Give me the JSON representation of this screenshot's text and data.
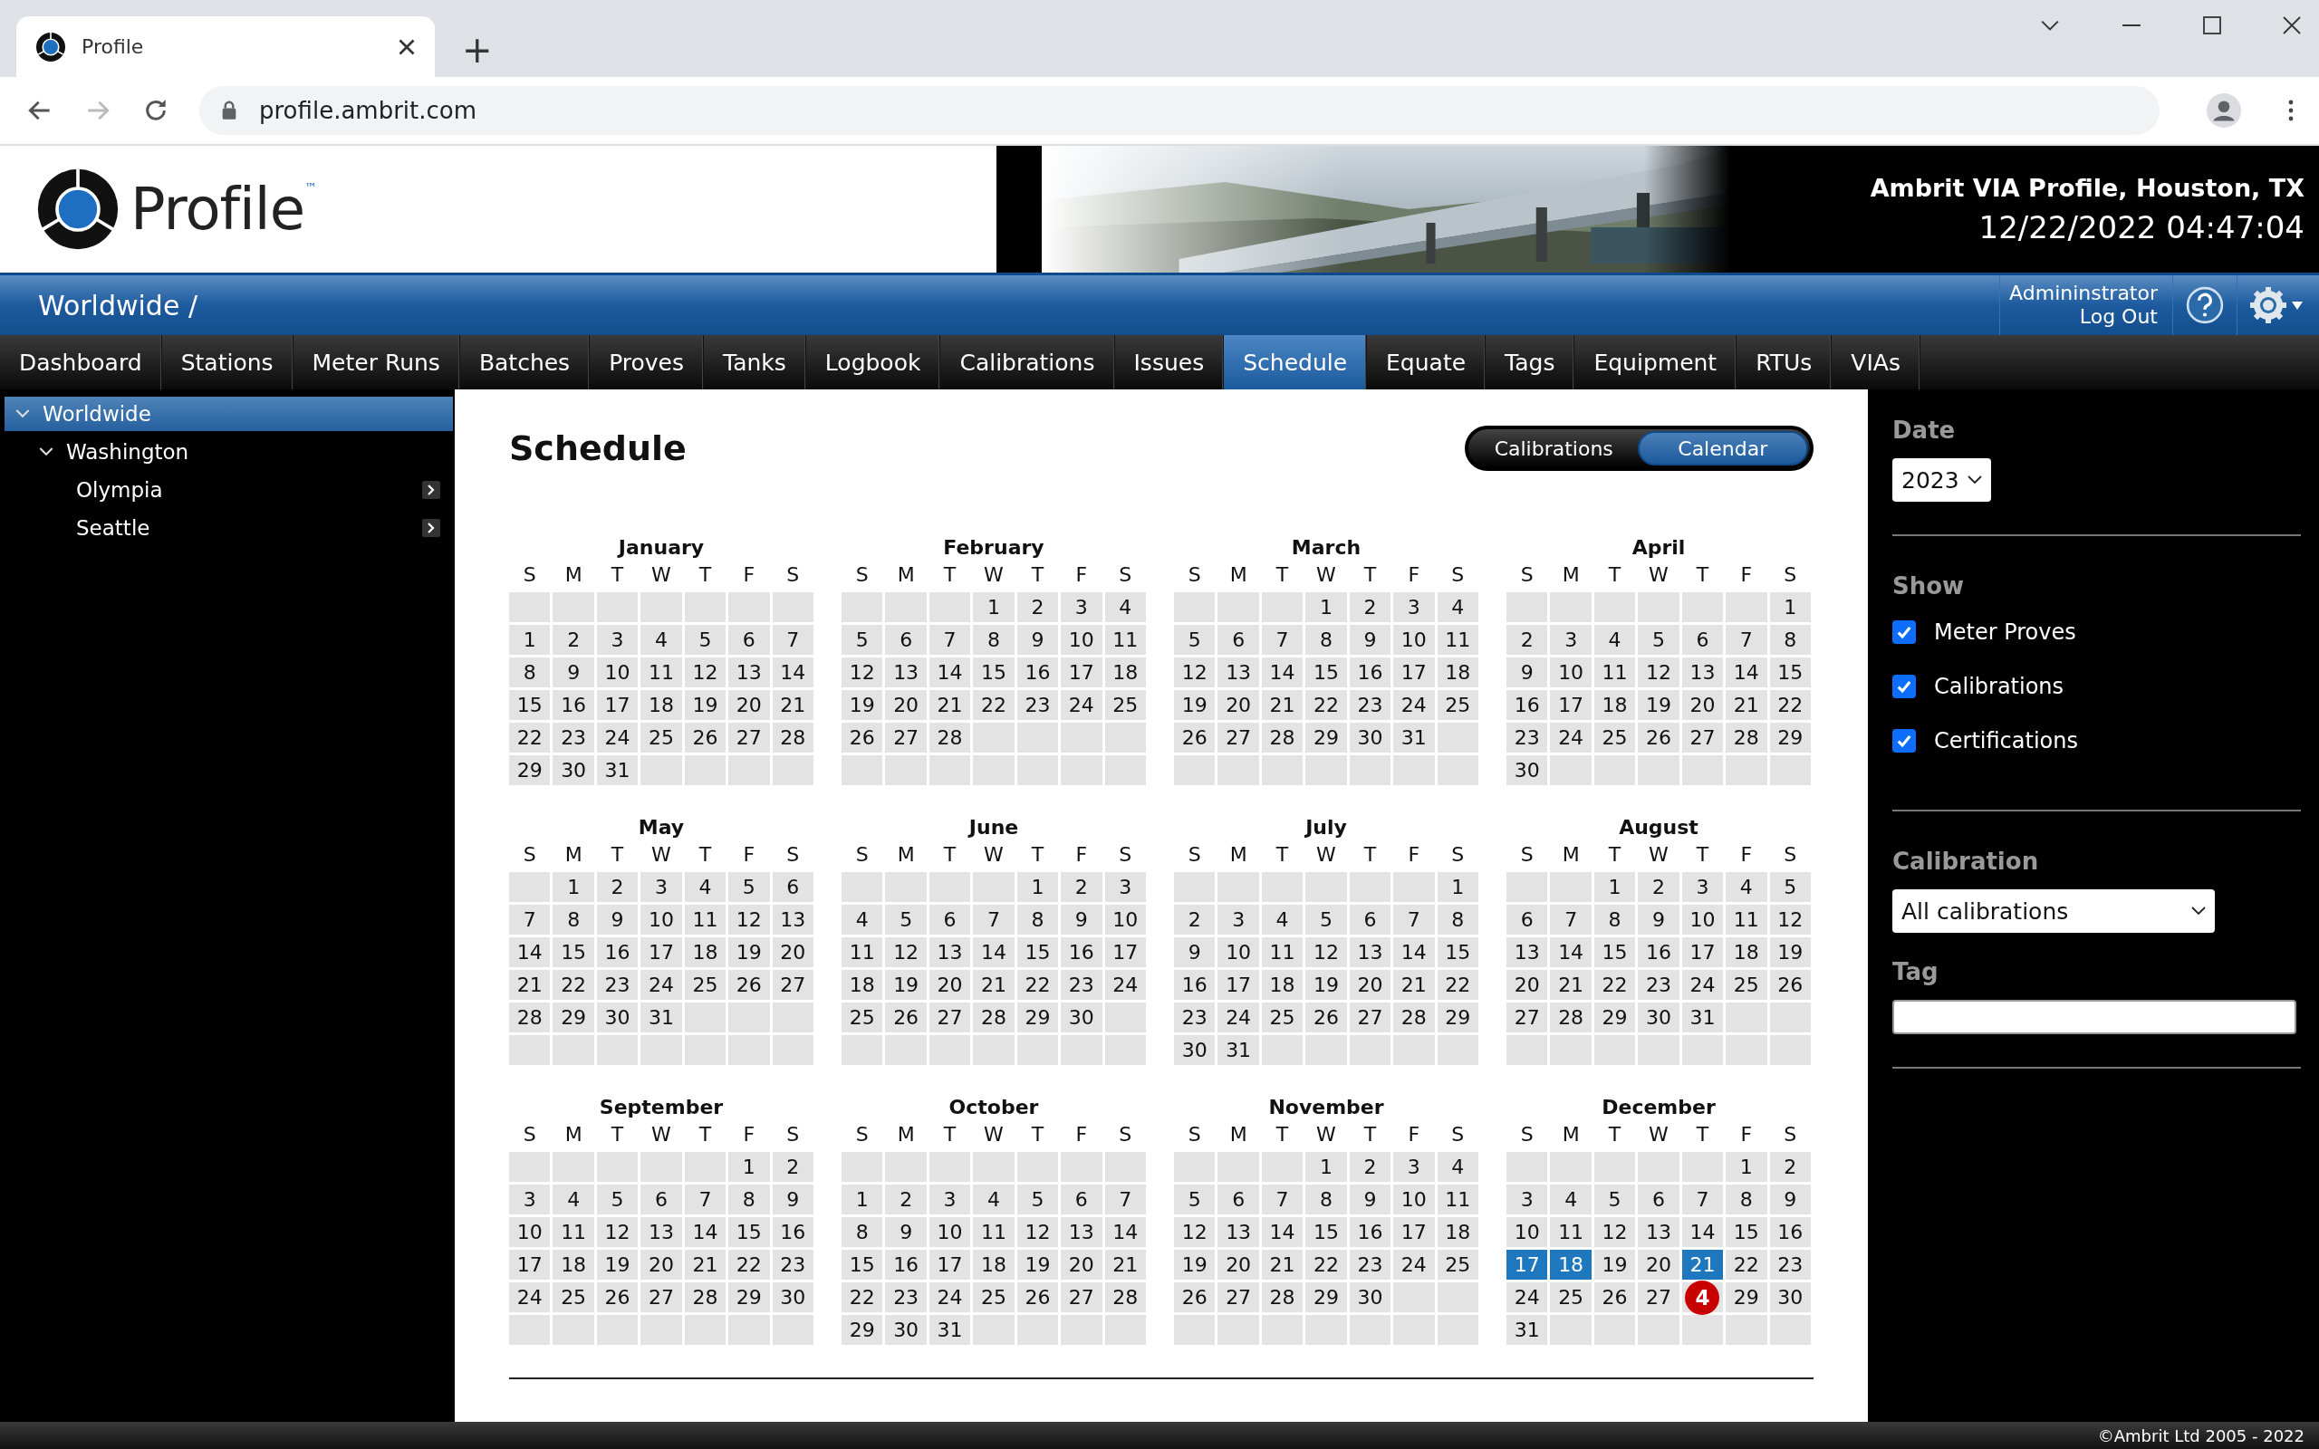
{
  "browser": {
    "tab_title": "Profile",
    "new_tab": "+",
    "url": "profile.ambrit.com"
  },
  "header": {
    "logo_text": "Profile",
    "trademark": "™",
    "site": "Ambrit VIA Profile, Houston, TX",
    "datetime": "12/22/2022 04:47:04"
  },
  "breadcrumb": "Worldwide /",
  "user": {
    "name": "Admininstrator",
    "logout": "Log Out"
  },
  "nav": [
    {
      "label": "Dashboard",
      "selected": false
    },
    {
      "label": "Stations",
      "selected": false
    },
    {
      "label": "Meter Runs",
      "selected": false
    },
    {
      "label": "Batches",
      "selected": false
    },
    {
      "label": "Proves",
      "selected": false
    },
    {
      "label": "Tanks",
      "selected": false
    },
    {
      "label": "Logbook",
      "selected": false
    },
    {
      "label": "Calibrations",
      "selected": false
    },
    {
      "label": "Issues",
      "selected": false
    },
    {
      "label": "Schedule",
      "selected": true
    },
    {
      "label": "Equate",
      "selected": false
    },
    {
      "label": "Tags",
      "selected": false
    },
    {
      "label": "Equipment",
      "selected": false
    },
    {
      "label": "RTUs",
      "selected": false
    },
    {
      "label": "VIAs",
      "selected": false
    }
  ],
  "tree": [
    {
      "label": "Worldwide",
      "selected": true,
      "expanded": true,
      "children": [
        {
          "label": "Washington",
          "selected": false,
          "expanded": true,
          "children": [
            {
              "label": "Olympia",
              "selected": false
            },
            {
              "label": "Seattle",
              "selected": false
            }
          ]
        }
      ]
    }
  ],
  "page_title": "Schedule",
  "view_toggle": [
    {
      "label": "Calibrations",
      "selected": false
    },
    {
      "label": "Calendar",
      "selected": true
    }
  ],
  "months": [
    {
      "name": "January",
      "weekdays": [
        "S",
        "M",
        "T",
        "W",
        "T",
        "F",
        "S"
      ],
      "weeks": [
        [
          {
            "kind": "blank"
          },
          {
            "kind": "blank"
          },
          {
            "kind": "blank"
          },
          {
            "kind": "blank"
          },
          {
            "kind": "blank"
          },
          {
            "kind": "blank"
          },
          {
            "kind": "blank"
          }
        ],
        [
          "1",
          "2",
          "3",
          "4",
          "5",
          "6",
          "7"
        ],
        [
          "8",
          "9",
          "10",
          "11",
          "12",
          "13",
          "14"
        ],
        [
          "15",
          "16",
          "17",
          "18",
          "19",
          "20",
          "21"
        ],
        [
          "22",
          "23",
          "24",
          "25",
          "26",
          "27",
          "28"
        ],
        [
          "29",
          "30",
          "31",
          {
            "kind": "blank"
          },
          {
            "kind": "blank"
          },
          {
            "kind": "blank"
          },
          {
            "kind": "blank"
          }
        ]
      ]
    },
    {
      "name": "February",
      "weekdays": [
        "S",
        "M",
        "T",
        "W",
        "T",
        "F",
        "S"
      ],
      "weeks": [
        [
          {
            "kind": "blank"
          },
          {
            "kind": "blank"
          },
          {
            "kind": "blank"
          },
          "1",
          "2",
          "3",
          "4"
        ],
        [
          "5",
          "6",
          "7",
          "8",
          "9",
          "10",
          "11"
        ],
        [
          "12",
          "13",
          "14",
          "15",
          "16",
          "17",
          "18"
        ],
        [
          "19",
          "20",
          "21",
          "22",
          "23",
          "24",
          "25"
        ],
        [
          "26",
          "27",
          "28",
          {
            "kind": "blank"
          },
          {
            "kind": "blank"
          },
          {
            "kind": "blank"
          },
          {
            "kind": "blank"
          }
        ],
        [
          {
            "kind": "blank"
          },
          {
            "kind": "blank"
          },
          {
            "kind": "blank"
          },
          {
            "kind": "blank"
          },
          {
            "kind": "blank"
          },
          {
            "kind": "blank"
          },
          {
            "kind": "blank"
          }
        ]
      ]
    },
    {
      "name": "March",
      "weekdays": [
        "S",
        "M",
        "T",
        "W",
        "T",
        "F",
        "S"
      ],
      "weeks": [
        [
          {
            "kind": "blank"
          },
          {
            "kind": "blank"
          },
          {
            "kind": "blank"
          },
          "1",
          "2",
          "3",
          "4"
        ],
        [
          "5",
          "6",
          "7",
          "8",
          "9",
          "10",
          "11"
        ],
        [
          "12",
          "13",
          "14",
          "15",
          "16",
          "17",
          "18"
        ],
        [
          "19",
          "20",
          "21",
          "22",
          "23",
          "24",
          "25"
        ],
        [
          "26",
          "27",
          "28",
          "29",
          "30",
          "31",
          {
            "kind": "blank"
          }
        ],
        [
          {
            "kind": "blank"
          },
          {
            "kind": "blank"
          },
          {
            "kind": "blank"
          },
          {
            "kind": "blank"
          },
          {
            "kind": "blank"
          },
          {
            "kind": "blank"
          },
          {
            "kind": "blank"
          }
        ]
      ]
    },
    {
      "name": "April",
      "weekdays": [
        "S",
        "M",
        "T",
        "W",
        "T",
        "F",
        "S"
      ],
      "weeks": [
        [
          {
            "kind": "blank"
          },
          {
            "kind": "blank"
          },
          {
            "kind": "blank"
          },
          {
            "kind": "blank"
          },
          {
            "kind": "blank"
          },
          {
            "kind": "blank"
          },
          "1"
        ],
        [
          "2",
          "3",
          "4",
          "5",
          "6",
          "7",
          "8"
        ],
        [
          "9",
          "10",
          "11",
          "12",
          "13",
          "14",
          "15"
        ],
        [
          "16",
          "17",
          "18",
          "19",
          "20",
          "21",
          "22"
        ],
        [
          "23",
          "24",
          "25",
          "26",
          "27",
          "28",
          "29"
        ],
        [
          "30",
          {
            "kind": "blank"
          },
          {
            "kind": "blank"
          },
          {
            "kind": "blank"
          },
          {
            "kind": "blank"
          },
          {
            "kind": "blank"
          },
          {
            "kind": "blank"
          }
        ]
      ]
    },
    {
      "name": "May",
      "weekdays": [
        "S",
        "M",
        "T",
        "W",
        "T",
        "F",
        "S"
      ],
      "weeks": [
        [
          {
            "kind": "blank"
          },
          "1",
          "2",
          "3",
          "4",
          "5",
          "6"
        ],
        [
          "7",
          "8",
          "9",
          "10",
          "11",
          "12",
          "13"
        ],
        [
          "14",
          "15",
          "16",
          "17",
          "18",
          "19",
          "20"
        ],
        [
          "21",
          "22",
          "23",
          "24",
          "25",
          "26",
          "27"
        ],
        [
          "28",
          "29",
          "30",
          "31",
          {
            "kind": "blank"
          },
          {
            "kind": "blank"
          },
          {
            "kind": "blank"
          }
        ],
        [
          {
            "kind": "blank"
          },
          {
            "kind": "blank"
          },
          {
            "kind": "blank"
          },
          {
            "kind": "blank"
          },
          {
            "kind": "blank"
          },
          {
            "kind": "blank"
          },
          {
            "kind": "blank"
          }
        ]
      ]
    },
    {
      "name": "June",
      "weekdays": [
        "S",
        "M",
        "T",
        "W",
        "T",
        "F",
        "S"
      ],
      "weeks": [
        [
          {
            "kind": "blank"
          },
          {
            "kind": "blank"
          },
          {
            "kind": "blank"
          },
          {
            "kind": "blank"
          },
          "1",
          "2",
          "3"
        ],
        [
          "4",
          "5",
          "6",
          "7",
          "8",
          "9",
          "10"
        ],
        [
          "11",
          "12",
          "13",
          "14",
          "15",
          "16",
          "17"
        ],
        [
          "18",
          "19",
          "20",
          "21",
          "22",
          "23",
          "24"
        ],
        [
          "25",
          "26",
          "27",
          "28",
          "29",
          "30",
          {
            "kind": "blank"
          }
        ],
        [
          {
            "kind": "blank"
          },
          {
            "kind": "blank"
          },
          {
            "kind": "blank"
          },
          {
            "kind": "blank"
          },
          {
            "kind": "blank"
          },
          {
            "kind": "blank"
          },
          {
            "kind": "blank"
          }
        ]
      ]
    },
    {
      "name": "July",
      "weekdays": [
        "S",
        "M",
        "T",
        "W",
        "T",
        "F",
        "S"
      ],
      "weeks": [
        [
          {
            "kind": "blank"
          },
          {
            "kind": "blank"
          },
          {
            "kind": "blank"
          },
          {
            "kind": "blank"
          },
          {
            "kind": "blank"
          },
          {
            "kind": "blank"
          },
          "1"
        ],
        [
          "2",
          "3",
          "4",
          "5",
          "6",
          "7",
          "8"
        ],
        [
          "9",
          "10",
          "11",
          "12",
          "13",
          "14",
          "15"
        ],
        [
          "16",
          "17",
          "18",
          "19",
          "20",
          "21",
          "22"
        ],
        [
          "23",
          "24",
          "25",
          "26",
          "27",
          "28",
          "29"
        ],
        [
          "30",
          "31",
          {
            "kind": "blank"
          },
          {
            "kind": "blank"
          },
          {
            "kind": "blank"
          },
          {
            "kind": "blank"
          },
          {
            "kind": "blank"
          }
        ]
      ]
    },
    {
      "name": "August",
      "weekdays": [
        "S",
        "M",
        "T",
        "W",
        "T",
        "F",
        "S"
      ],
      "weeks": [
        [
          {
            "kind": "blank"
          },
          {
            "kind": "blank"
          },
          "1",
          "2",
          "3",
          "4",
          "5"
        ],
        [
          "6",
          "7",
          "8",
          "9",
          "10",
          "11",
          "12"
        ],
        [
          "13",
          "14",
          "15",
          "16",
          "17",
          "18",
          "19"
        ],
        [
          "20",
          "21",
          "22",
          "23",
          "24",
          "25",
          "26"
        ],
        [
          "27",
          "28",
          "29",
          "30",
          "31",
          {
            "kind": "blank"
          },
          {
            "kind": "blank"
          }
        ],
        [
          {
            "kind": "blank"
          },
          {
            "kind": "blank"
          },
          {
            "kind": "blank"
          },
          {
            "kind": "blank"
          },
          {
            "kind": "blank"
          },
          {
            "kind": "blank"
          },
          {
            "kind": "blank"
          }
        ]
      ]
    },
    {
      "name": "September",
      "weekdays": [
        "S",
        "M",
        "T",
        "W",
        "T",
        "F",
        "S"
      ],
      "weeks": [
        [
          {
            "kind": "blank"
          },
          {
            "kind": "blank"
          },
          {
            "kind": "blank"
          },
          {
            "kind": "blank"
          },
          {
            "kind": "blank"
          },
          "1",
          "2"
        ],
        [
          "3",
          "4",
          "5",
          "6",
          "7",
          "8",
          "9"
        ],
        [
          "10",
          "11",
          "12",
          "13",
          "14",
          "15",
          "16"
        ],
        [
          "17",
          "18",
          "19",
          "20",
          "21",
          "22",
          "23"
        ],
        [
          "24",
          "25",
          "26",
          "27",
          "28",
          "29",
          "30"
        ],
        [
          {
            "kind": "blank"
          },
          {
            "kind": "blank"
          },
          {
            "kind": "blank"
          },
          {
            "kind": "blank"
          },
          {
            "kind": "blank"
          },
          {
            "kind": "blank"
          },
          {
            "kind": "blank"
          }
        ]
      ]
    },
    {
      "name": "October",
      "weekdays": [
        "S",
        "M",
        "T",
        "W",
        "T",
        "F",
        "S"
      ],
      "weeks": [
        [
          {
            "kind": "blank"
          },
          {
            "kind": "blank"
          },
          {
            "kind": "blank"
          },
          {
            "kind": "blank"
          },
          {
            "kind": "blank"
          },
          {
            "kind": "blank"
          },
          {
            "kind": "blank"
          }
        ],
        [
          "1",
          "2",
          "3",
          "4",
          "5",
          "6",
          "7"
        ],
        [
          "8",
          "9",
          "10",
          "11",
          "12",
          "13",
          "14"
        ],
        [
          "15",
          "16",
          "17",
          "18",
          "19",
          "20",
          "21"
        ],
        [
          "22",
          "23",
          "24",
          "25",
          "26",
          "27",
          "28"
        ],
        [
          "29",
          "30",
          "31",
          {
            "kind": "blank"
          },
          {
            "kind": "blank"
          },
          {
            "kind": "blank"
          },
          {
            "kind": "blank"
          }
        ]
      ]
    },
    {
      "name": "November",
      "weekdays": [
        "S",
        "M",
        "T",
        "W",
        "T",
        "F",
        "S"
      ],
      "weeks": [
        [
          {
            "kind": "blank"
          },
          {
            "kind": "blank"
          },
          {
            "kind": "blank"
          },
          "1",
          "2",
          "3",
          "4"
        ],
        [
          "5",
          "6",
          "7",
          "8",
          "9",
          "10",
          "11"
        ],
        [
          "12",
          "13",
          "14",
          "15",
          "16",
          "17",
          "18"
        ],
        [
          "19",
          "20",
          "21",
          "22",
          "23",
          "24",
          "25"
        ],
        [
          "26",
          "27",
          "28",
          "29",
          "30",
          {
            "kind": "blank"
          },
          {
            "kind": "blank"
          }
        ],
        [
          {
            "kind": "blank"
          },
          {
            "kind": "blank"
          },
          {
            "kind": "blank"
          },
          {
            "kind": "blank"
          },
          {
            "kind": "blank"
          },
          {
            "kind": "blank"
          },
          {
            "kind": "blank"
          }
        ]
      ]
    },
    {
      "name": "December",
      "weekdays": [
        "S",
        "M",
        "T",
        "W",
        "T",
        "F",
        "S"
      ],
      "weeks": [
        [
          {
            "kind": "blank"
          },
          {
            "kind": "blank"
          },
          {
            "kind": "blank"
          },
          {
            "kind": "blank"
          },
          {
            "kind": "blank"
          },
          "1",
          "2"
        ],
        [
          "3",
          "4",
          "5",
          "6",
          "7",
          "8",
          "9"
        ],
        [
          "10",
          "11",
          "12",
          "13",
          "14",
          "15",
          "16"
        ],
        [
          {
            "kind": "marked",
            "day": "17"
          },
          {
            "kind": "marked",
            "day": "18"
          },
          "19",
          "20",
          {
            "kind": "marked",
            "day": "21"
          },
          "22",
          "23"
        ],
        [
          "24",
          "25",
          "26",
          "27",
          {
            "kind": "badge",
            "badge": "4"
          },
          "29",
          "30"
        ],
        [
          "31",
          {
            "kind": "blank"
          },
          {
            "kind": "blank"
          },
          {
            "kind": "blank"
          },
          {
            "kind": "blank"
          },
          {
            "kind": "blank"
          },
          {
            "kind": "blank"
          }
        ]
      ]
    }
  ],
  "filters": {
    "date_label": "Date",
    "year": "2023",
    "show_label": "Show",
    "show": [
      {
        "label": "Meter Proves",
        "checked": true
      },
      {
        "label": "Calibrations",
        "checked": true
      },
      {
        "label": "Certifications",
        "checked": true
      }
    ],
    "calibration_label": "Calibration",
    "calibration": "All calibrations",
    "tag_label": "Tag"
  },
  "footer": "©Ambrit Ltd 2005 - 2022"
}
